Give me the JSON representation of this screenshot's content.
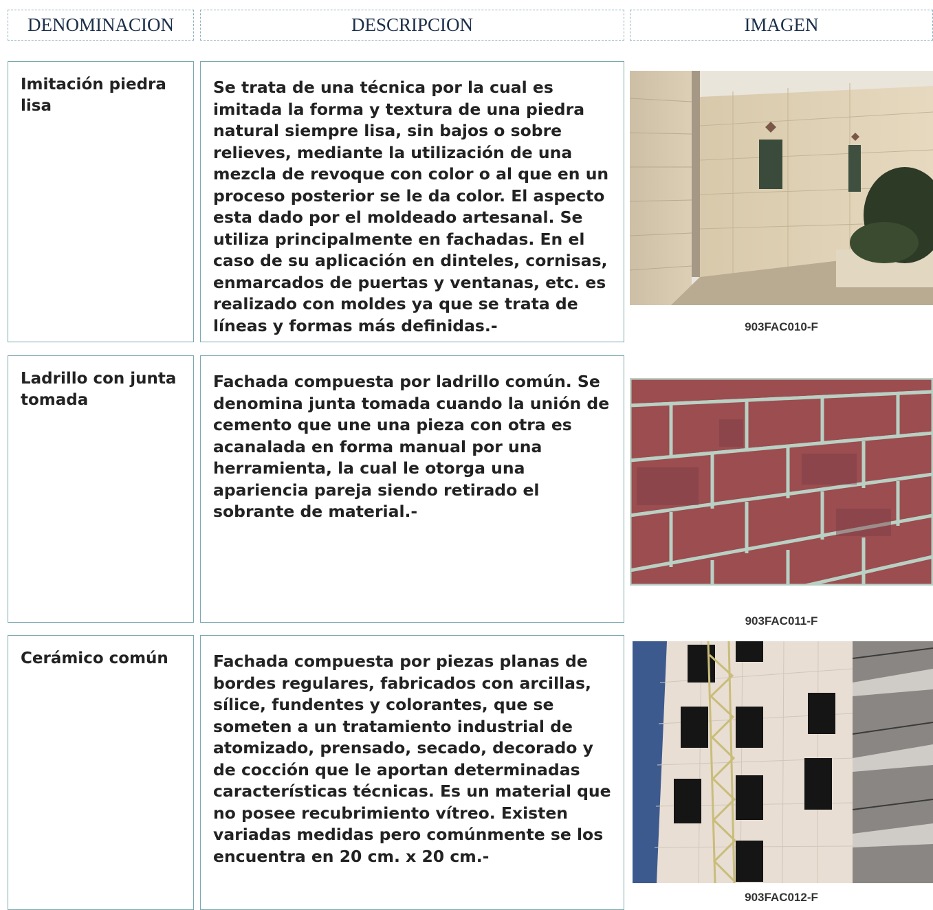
{
  "headers": {
    "denominacion": "DENOMINACION",
    "descripcion": "DESCRIPCION",
    "imagen": "IMAGEN"
  },
  "rows": [
    {
      "name": "Imitación piedra lisa",
      "description": "Se trata de una técnica por la cual es imitada la forma y textura de una piedra natural siempre lisa, sin bajos o sobre relieves, mediante la utilización de una mezcla de revoque con color o al que en un proceso posterior se le da color. El aspecto esta dado por el moldeado artesanal. Se utiliza principalmente en fachadas. En el caso de su aplicación en dinteles, cornisas, enmarcados de puertas y ventanas, etc. es realizado con moldes ya que se trata de líneas y formas más definidas.-",
      "code": "903FAC010-F"
    },
    {
      "name": "Ladrillo con junta tomada",
      "description": "Fachada compuesta por ladrillo común. Se denomina junta tomada cuando la unión de cemento que une una pieza con otra es acanalada en forma manual por una herramienta, la cual le otorga una apariencia pareja siendo retirado el sobrante de material.-",
      "code": "903FAC011-F"
    },
    {
      "name": "Cerámico común",
      "description": "Fachada compuesta por piezas planas de bordes regulares, fabricados con arcillas, sílice, fundentes y colorantes, que se someten a un tratamiento industrial de atomizado, prensado, secado, decorado y de cocción que le aportan determinadas características técnicas. Es un material que no posee recubrimiento vítreo. Existen variadas medidas pero comúnmente se los encuentra en 20 cm. x 20 cm.-",
      "code": "903FAC012-F"
    }
  ]
}
